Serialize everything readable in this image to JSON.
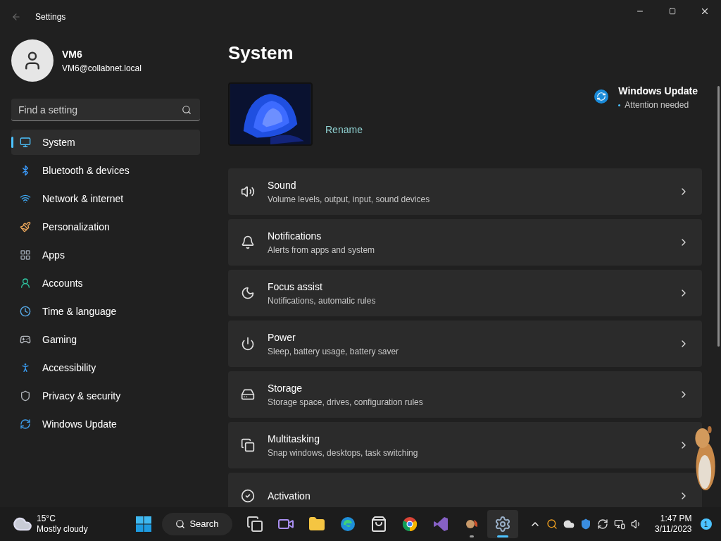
{
  "window": {
    "title": "Settings"
  },
  "account": {
    "name": "VM6",
    "email": "VM6@collabnet.local"
  },
  "search": {
    "placeholder": "Find a setting"
  },
  "sidebar": {
    "items": [
      {
        "label": "System",
        "kind": "system",
        "selected": true
      },
      {
        "label": "Bluetooth & devices",
        "kind": "bluetooth",
        "selected": false
      },
      {
        "label": "Network & internet",
        "kind": "network",
        "selected": false
      },
      {
        "label": "Personalization",
        "kind": "brush",
        "selected": false
      },
      {
        "label": "Apps",
        "kind": "apps",
        "selected": false
      },
      {
        "label": "Accounts",
        "kind": "accounts",
        "selected": false
      },
      {
        "label": "Time & language",
        "kind": "time",
        "selected": false
      },
      {
        "label": "Gaming",
        "kind": "gaming",
        "selected": false
      },
      {
        "label": "Accessibility",
        "kind": "accessibility",
        "selected": false
      },
      {
        "label": "Privacy & security",
        "kind": "privacy",
        "selected": false
      },
      {
        "label": "Windows Update",
        "kind": "update",
        "selected": false
      }
    ]
  },
  "page": {
    "title": "System",
    "rename": "Rename",
    "update": {
      "title": "Windows Update",
      "status": "Attention needed"
    },
    "cards": [
      {
        "kind": "sound",
        "title": "Sound",
        "description": "Volume levels, output, input, sound devices"
      },
      {
        "kind": "notifications",
        "title": "Notifications",
        "description": "Alerts from apps and system"
      },
      {
        "kind": "focus",
        "title": "Focus assist",
        "description": "Notifications, automatic rules"
      },
      {
        "kind": "power",
        "title": "Power",
        "description": "Sleep, battery usage, battery saver"
      },
      {
        "kind": "storage",
        "title": "Storage",
        "description": "Storage space, drives, configuration rules"
      },
      {
        "kind": "multitasking",
        "title": "Multitasking",
        "description": "Snap windows, desktops, task switching"
      },
      {
        "kind": "activation",
        "title": "Activation"
      }
    ]
  },
  "taskbar": {
    "weather": {
      "temp": "15°C",
      "condition": "Mostly cloudy"
    },
    "search": "Search",
    "apps": [
      {
        "kind": "taskview",
        "selected": false,
        "running": false
      },
      {
        "kind": "meet",
        "selected": false,
        "running": false
      },
      {
        "kind": "files",
        "selected": false,
        "running": false
      },
      {
        "kind": "edge",
        "selected": false,
        "running": false
      },
      {
        "kind": "store",
        "selected": false,
        "running": false
      },
      {
        "kind": "chrome",
        "selected": false,
        "running": false
      },
      {
        "kind": "studio",
        "selected": false,
        "running": false
      },
      {
        "kind": "squirrel",
        "selected": false,
        "running": true
      },
      {
        "kind": "settings",
        "selected": true,
        "running": true
      }
    ],
    "time": "1:47 PM",
    "date": "3/11/2023",
    "notifications": "1"
  }
}
